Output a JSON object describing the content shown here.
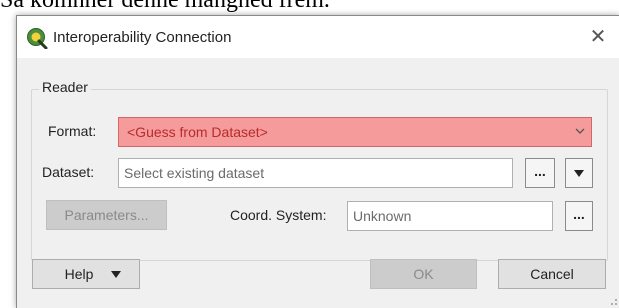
{
  "background": {
    "snippet_text": "Sa komnner dehne manghed frem."
  },
  "window": {
    "title": "Interoperability Connection",
    "close_glyph": "✕"
  },
  "reader": {
    "group_label": "Reader",
    "format_label": "Format:",
    "format_value": "<Guess from Dataset>",
    "dataset_label": "Dataset:",
    "dataset_placeholder": "Select existing dataset",
    "browse_label": "...",
    "parameters_label": "Parameters...",
    "coord_label": "Coord. System:",
    "coord_value": "Unknown",
    "coord_browse_label": "..."
  },
  "footer": {
    "help_label": "Help",
    "ok_label": "OK",
    "cancel_label": "Cancel"
  },
  "colors": {
    "invalid_field_bg": "#f59b9b",
    "invalid_field_text": "#b82c2c"
  }
}
